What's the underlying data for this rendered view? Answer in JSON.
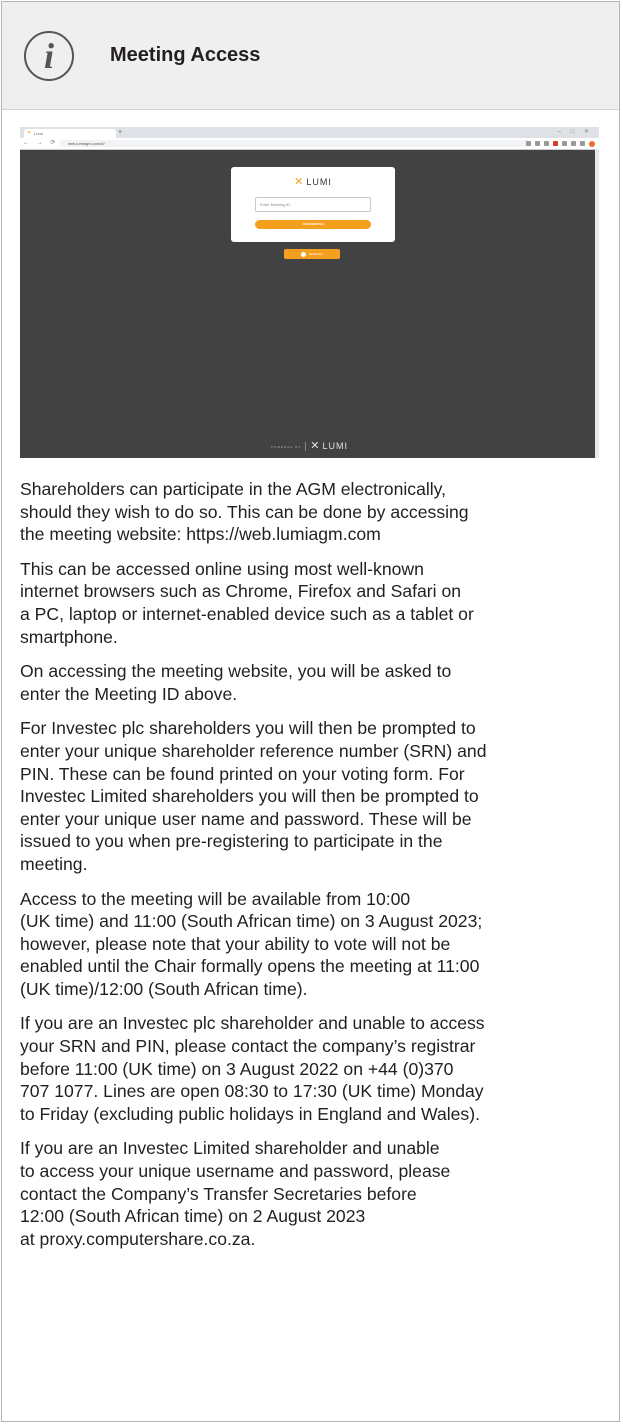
{
  "header": {
    "title": "Meeting Access",
    "icon": "info-icon"
  },
  "screenshot": {
    "tab_label": "Lumi",
    "url": "web.lumiagm.com/#/",
    "logo_text": "LUMI",
    "meeting_id_placeholder": "Enter Meeting ID",
    "join_button_label": "JOIN MEETING",
    "language_button_label": "ENGLISH",
    "powered_by": "POWERED BY",
    "footer_logo_text": "LUMI",
    "accent_color": "#f59f1f",
    "background_color": "#424242"
  },
  "paragraphs": [
    "Shareholders can participate in the AGM electronically,\nshould they wish to do so. This can be done by accessing\nthe meeting website: https://web.lumiagm.com",
    "This can be accessed online using most well-known\ninternet browsers such as Chrome, Firefox and Safari on\na PC, laptop or internet-enabled device such as a tablet or\nsmartphone.",
    "On accessing the meeting website, you will be asked to\nenter the Meeting ID above.",
    "For Investec plc shareholders you will then be prompted to\nenter your unique shareholder reference number (SRN) and\nPIN. These can be found printed on your voting form. For\nInvestec Limited shareholders you will then be prompted to\nenter your unique user name and password. These will be\nissued to you when pre-registering to participate in the\nmeeting.",
    "Access to the meeting will be available from 10:00\n(UK time) and 11:00 (South African time) on 3 August 2023;\nhowever, please note that your ability to vote will not be\nenabled until the Chair formally opens the meeting at 11:00\n(UK time)/12:00 (South African time).",
    "If you are an Investec plc shareholder and unable to access\nyour SRN and PIN, please contact the company’s registrar\nbefore 11:00 (UK time) on 3 August 2022 on +44 (0)370\n707 1077. Lines are open 08:30 to 17:30 (UK time) Monday\nto Friday (excluding public holidays in England and Wales).",
    "If you are an Investec Limited shareholder and unable\nto access your unique username and password, please\ncontact the Company’s Transfer Secretaries before\n12:00 (South African time) on 2 August 2023\nat proxy.computershare.co.za."
  ]
}
